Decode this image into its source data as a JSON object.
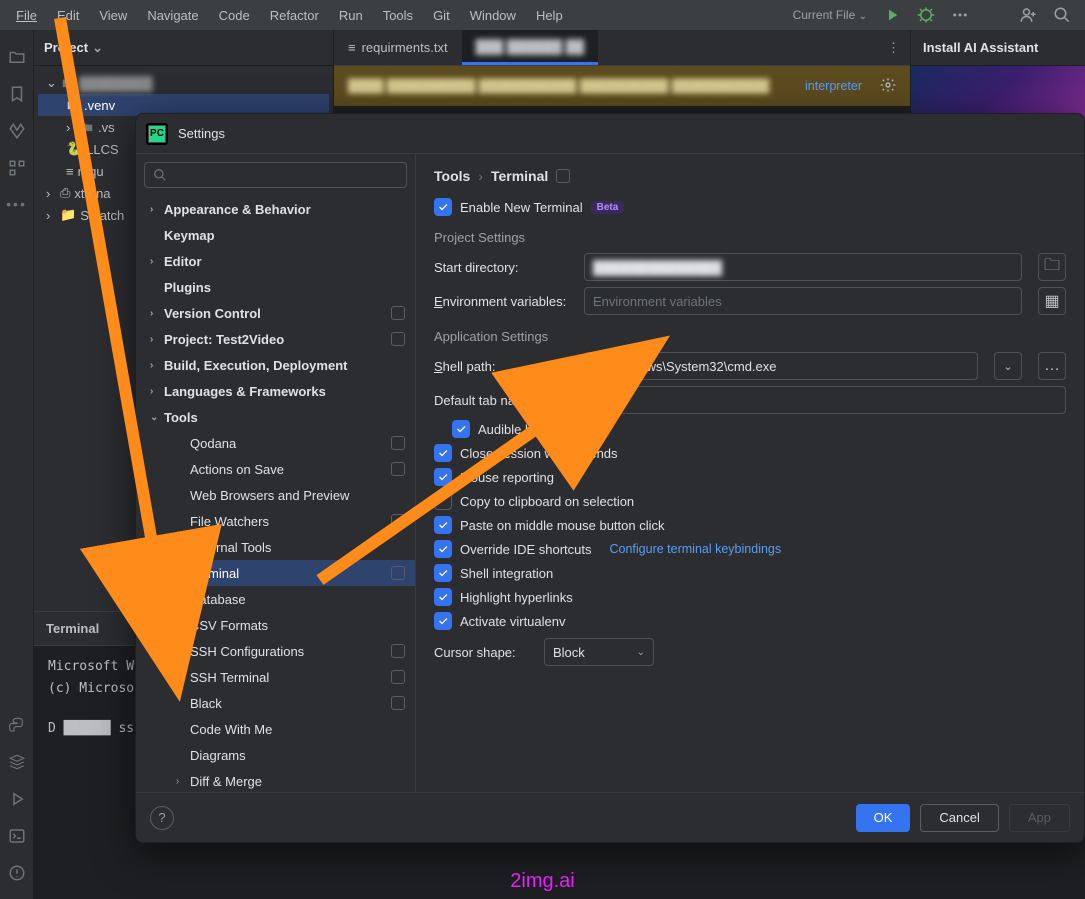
{
  "menu": {
    "file": "File",
    "edit": "Edit",
    "view": "View",
    "navigate": "Navigate",
    "code": "Code",
    "refactor": "Refactor",
    "run": "Run",
    "tools": "Tools",
    "git": "Git",
    "window": "Window",
    "help": "Help",
    "current_file": "Current File"
  },
  "project": {
    "title": "Project",
    "root": "████████",
    "nodes": [
      {
        "label": ".venv",
        "sel": true
      },
      {
        "label": ".vs"
      },
      {
        "label": "LLCS"
      },
      {
        "label": "requ"
      },
      {
        "label": "xterna"
      },
      {
        "label": "Scratch"
      }
    ]
  },
  "tabs": {
    "req": "requirments.txt",
    "other": "███ ██████ ██"
  },
  "banner": {
    "text": "████ ██████████ ███████████ ██████████  ███████████",
    "link": "interpreter"
  },
  "ai": {
    "title": "Install AI Assistant"
  },
  "terminal": {
    "title": "Terminal",
    "l1": "Microsoft Wi",
    "l2": "(c) Microsof",
    "l3": "D ██████ ss"
  },
  "dialog": {
    "title": "Settings",
    "search_ph": "",
    "tree_top": [
      {
        "label": "Appearance & Behavior",
        "bold": true,
        "arrow": "›"
      },
      {
        "label": "Keymap",
        "bold": true
      },
      {
        "label": "Editor",
        "bold": true,
        "arrow": "›"
      },
      {
        "label": "Plugins",
        "bold": true
      },
      {
        "label": "Version Control",
        "bold": true,
        "arrow": "›",
        "pill": true
      },
      {
        "label": "Project: Test2Video",
        "bold": true,
        "arrow": "›",
        "pill": true
      },
      {
        "label": "Build, Execution, Deployment",
        "bold": true,
        "arrow": "›"
      },
      {
        "label": "Languages & Frameworks",
        "bold": true,
        "arrow": "›"
      },
      {
        "label": "Tools",
        "bold": true,
        "arrow": "⌄"
      }
    ],
    "tree_tools": [
      {
        "label": "Qodana",
        "pill": true
      },
      {
        "label": "Actions on Save",
        "pill": true
      },
      {
        "label": "Web Browsers and Preview"
      },
      {
        "label": "File Watchers",
        "pill": true
      },
      {
        "label": "External Tools"
      },
      {
        "label": "Terminal",
        "sel": true,
        "pill": true
      },
      {
        "label": "Database",
        "arrow": "›"
      },
      {
        "label": "CSV Formats"
      },
      {
        "label": "SSH Configurations",
        "pill": true
      },
      {
        "label": "SSH Terminal",
        "pill": true
      },
      {
        "label": "Black",
        "pill": true
      },
      {
        "label": "Code With Me"
      },
      {
        "label": "Diagrams"
      },
      {
        "label": "Diff & Merge",
        "arrow": "›"
      }
    ],
    "crumb_tools": "Tools",
    "crumb_terminal": "Terminal",
    "enable_new": "Enable New Terminal",
    "beta": "Beta",
    "proj_settings": "Project Settings",
    "start_dir": "Start directory:",
    "start_dir_val": "██████████████",
    "env_vars": "Environment variables:",
    "env_vars_ph": "Environment variables",
    "app_settings": "Application Settings",
    "shell_path": "Shell path:",
    "shell_path_val": "C:\\Windows\\System32\\cmd.exe",
    "tab_name": "Default tab name:",
    "tab_name_val": "Local",
    "checks": [
      {
        "label": "Audible bell",
        "on": true,
        "hide": true
      },
      {
        "label": "Close session when it ends",
        "on": true
      },
      {
        "label": "Mouse reporting",
        "on": true
      },
      {
        "label": "Copy to clipboard on selection",
        "on": false
      },
      {
        "label": "Paste on middle mouse button click",
        "on": true
      },
      {
        "label": "Override IDE shortcuts",
        "on": true,
        "link": "Configure terminal keybindings"
      },
      {
        "label": "Shell integration",
        "on": true
      },
      {
        "label": "Highlight hyperlinks",
        "on": true
      },
      {
        "label": "Activate virtualenv",
        "on": true
      }
    ],
    "cursor_shape": "Cursor shape:",
    "cursor_val": "Block",
    "ok": "OK",
    "cancel": "Cancel",
    "apply": "App"
  },
  "watermark": "2img.ai"
}
